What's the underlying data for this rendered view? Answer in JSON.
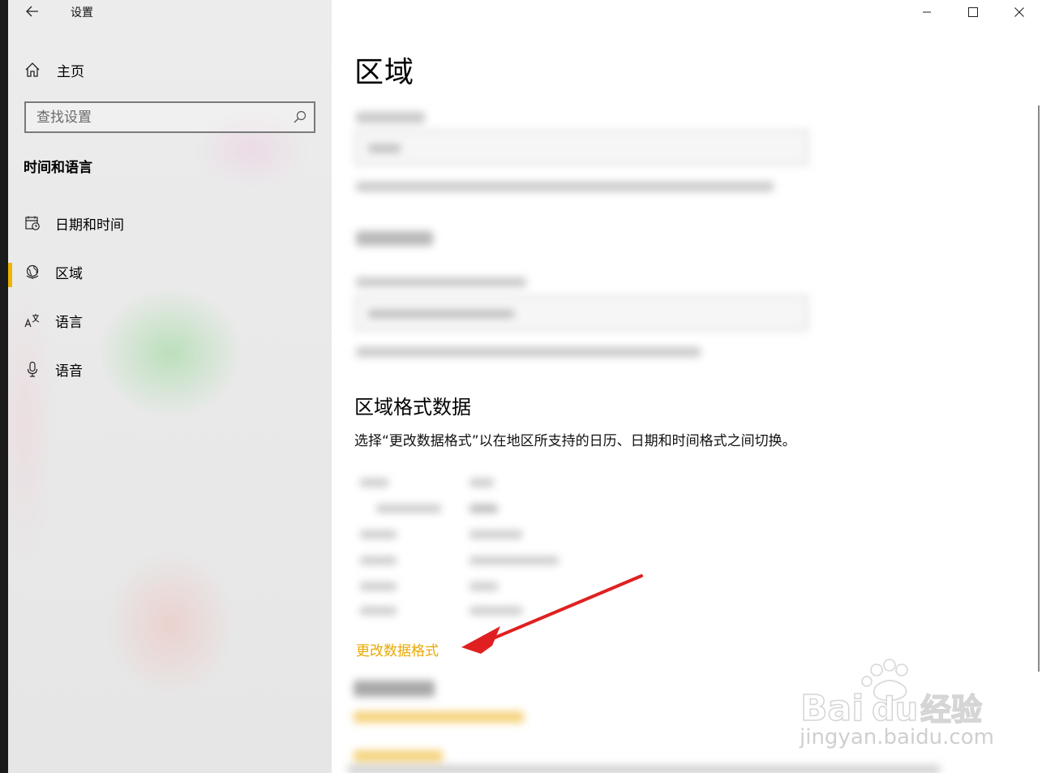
{
  "app": {
    "title": "设置"
  },
  "sidebar": {
    "home_label": "主页",
    "search_placeholder": "查找设置",
    "section_title": "时间和语言",
    "items": [
      {
        "label": "日期和时间",
        "icon": "calendar-clock-icon",
        "active": false
      },
      {
        "label": "区域",
        "icon": "globe-icon",
        "active": true
      },
      {
        "label": "语言",
        "icon": "language-icon",
        "active": false
      },
      {
        "label": "语音",
        "icon": "microphone-icon",
        "active": false
      }
    ]
  },
  "content": {
    "page_title": "区域",
    "regional_format_heading": "区域格式数据",
    "regional_format_desc": "选择“更改数据格式”以在地区所支持的日历、日期和时间格式之间切换。",
    "change_link": "更改数据格式"
  },
  "watermark": {
    "text": "Bai",
    "text_mid": "du",
    "text_cn": "经验",
    "sub": "jingyan.baidu.com"
  },
  "colors": {
    "accent": "#f0b400",
    "link": "#e8a800",
    "arrow": "#e02020"
  }
}
